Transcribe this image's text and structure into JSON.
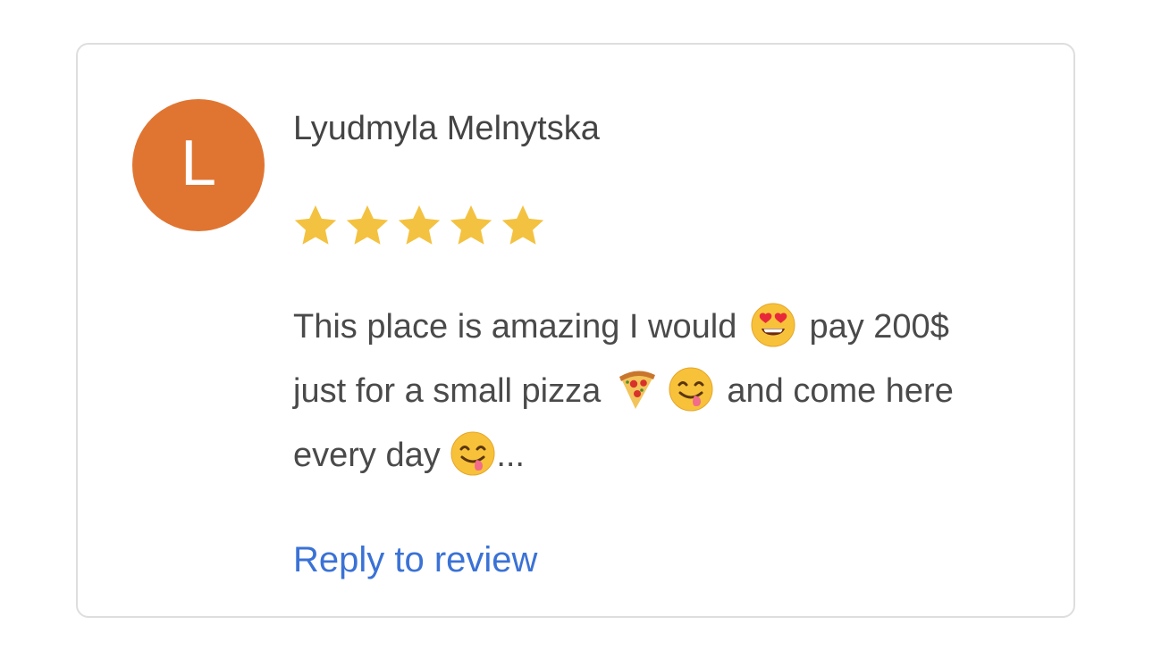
{
  "review": {
    "avatar_letter": "L",
    "reviewer_name": "Lyudmyla Melnytska",
    "rating": 5,
    "rating_max": 5,
    "text": {
      "line1_a": "This place is amazing I would ",
      "line1_b": " pay 200$",
      "line2_a": "just for a small pizza ",
      "line2_b": " and come here",
      "line3_a": "every day ",
      "line3_b": "..."
    },
    "emoji_names": [
      "heart-eyes-emoji",
      "pizza-emoji",
      "yum-emoji",
      "yum-emoji"
    ],
    "reply_label": "Reply to review"
  },
  "colors": {
    "avatar_bg": "#e07532",
    "star": "#f4c241",
    "link": "#3a72d6",
    "text": "#4a4a4a",
    "border": "#dedede"
  }
}
